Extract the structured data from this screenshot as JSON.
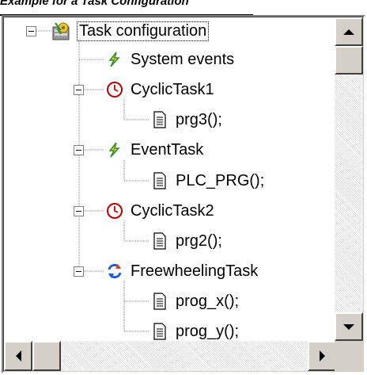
{
  "caption": "Example for a Task Configuration",
  "tree": {
    "root": {
      "label": "Task configuration",
      "icon": "task-configuration-icon"
    },
    "items": [
      {
        "label": "System events",
        "icon": "lightning-icon",
        "level": 1
      },
      {
        "label": "CyclicTask1",
        "icon": "clock-icon",
        "level": 1
      },
      {
        "label": "prg3();",
        "icon": "document-icon",
        "level": 2
      },
      {
        "label": "EventTask",
        "icon": "lightning-icon",
        "level": 1
      },
      {
        "label": "PLC_PRG();",
        "icon": "document-icon",
        "level": 2
      },
      {
        "label": "CyclicTask2",
        "icon": "clock-icon",
        "level": 1
      },
      {
        "label": "prg2();",
        "icon": "document-icon",
        "level": 2
      },
      {
        "label": "FreewheelingTask",
        "icon": "freewheeling-icon",
        "level": 1
      },
      {
        "label": "prog_x();",
        "icon": "document-icon",
        "level": 2
      },
      {
        "label": "prog_y();",
        "icon": "document-icon",
        "level": 2
      }
    ]
  },
  "colors": {
    "clock": "#c00000",
    "lightning": "#2f8f2f",
    "freewheel_blue": "#1e5bd6",
    "freewheel_red": "#e03c1e"
  }
}
